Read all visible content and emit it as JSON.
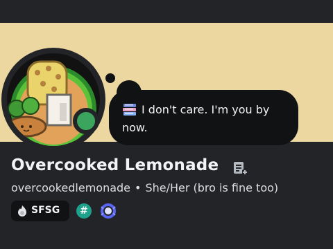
{
  "profile": {
    "display_name": "Overcooked Lemonade",
    "username": "overcookedlemonade",
    "separator": "•",
    "pronouns": "She/Her (bro is fine too)",
    "status_text": "I don't care. I'm you by now.",
    "status_emoji": "books-icon",
    "presence": "online",
    "tag": "SFSG",
    "badge_hash": "#"
  },
  "colors": {
    "banner": "#ecd7a1",
    "background": "#232428",
    "bubble": "#111214",
    "online": "#3ba55d",
    "hash_badge": "#1fa28b",
    "wreath_badge": "#5865f2"
  }
}
